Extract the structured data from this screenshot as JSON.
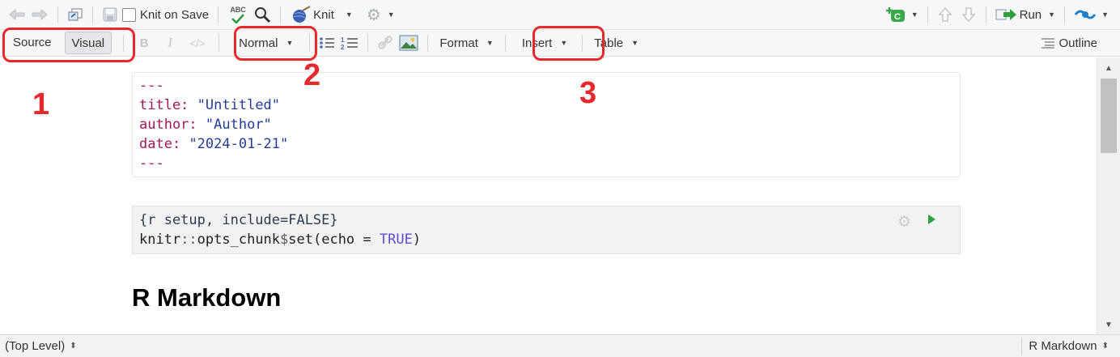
{
  "toolbar_top": {
    "knit_on_save_label": "Knit on Save",
    "knit_label": "Knit",
    "run_label": "Run",
    "abc_label": "ABC"
  },
  "toolbar_format": {
    "source_label": "Source",
    "visual_label": "Visual",
    "bold_label": "B",
    "italic_label": "I",
    "code_label": "</>",
    "style_label": "Normal",
    "format_label": "Format",
    "insert_label": "Insert",
    "table_label": "Table",
    "outline_label": "Outline",
    "active_mode": "Visual"
  },
  "annotations": [
    "1",
    "2",
    "3"
  ],
  "annotation_color": "#e8282b",
  "yaml": {
    "dash_open": "---",
    "title_key": "title:",
    "title_val": "\"Untitled\"",
    "author_key": "author:",
    "author_val": "\"Author\"",
    "date_key": "date:",
    "date_val": "\"2024-01-21\"",
    "dash_close": "---"
  },
  "chunk": {
    "header": "{r setup, include=FALSE}",
    "line2_a": "knitr",
    "line2_op": "::",
    "line2_b": "opts_chunk",
    "line2_dollar": "$",
    "line2_c": "set(echo = ",
    "line2_true": "TRUE",
    "line2_end": ")"
  },
  "heading": "R Markdown",
  "status": {
    "scope": "(Top Level)",
    "language": "R Markdown"
  },
  "colors": {
    "run_green": "#2e9e3e",
    "publish_blue": "#1f7fc8"
  }
}
